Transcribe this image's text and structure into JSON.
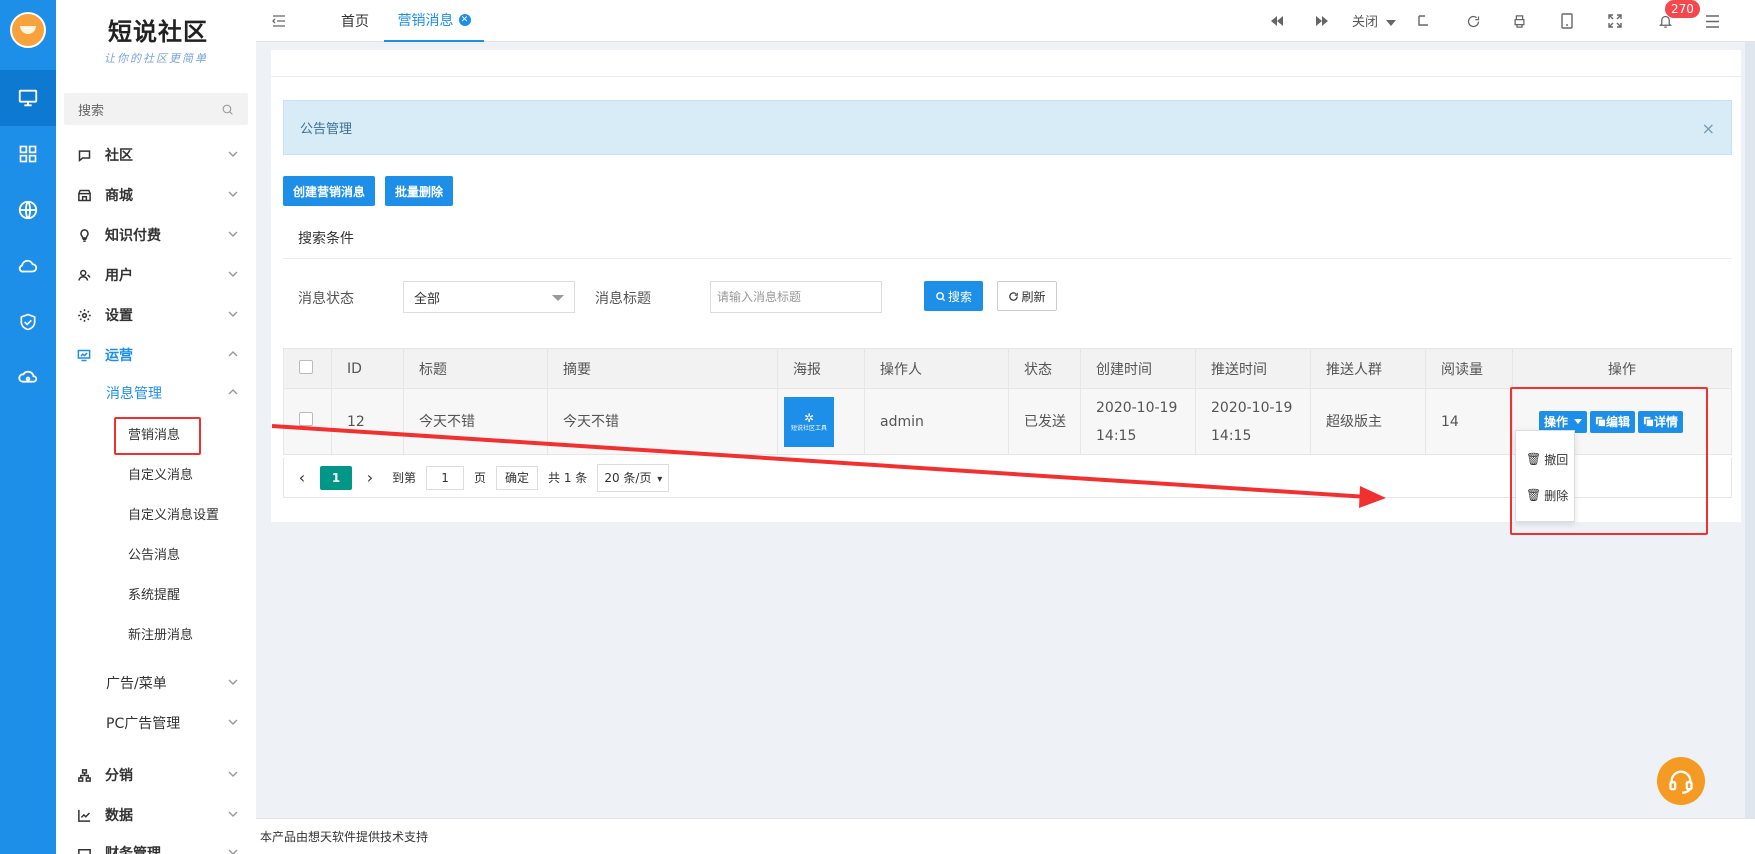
{
  "brand": {
    "name": "短说社区",
    "slogan": "让你的社区更简单"
  },
  "sidebar": {
    "search_placeholder": "搜索",
    "menu": [
      {
        "label": "社区"
      },
      {
        "label": "商城"
      },
      {
        "label": "知识付费"
      },
      {
        "label": "用户"
      },
      {
        "label": "设置"
      },
      {
        "label": "运营"
      }
    ],
    "sub_group": "消息管理",
    "sub_items": [
      "营销消息",
      "自定义消息",
      "自定义消息设置",
      "公告消息",
      "系统提醒",
      "新注册消息"
    ],
    "more": [
      "广告/菜单",
      "PC广告管理"
    ],
    "bottom_menu": [
      {
        "label": "分销"
      },
      {
        "label": "数据"
      },
      {
        "label": "财务管理"
      }
    ]
  },
  "topbar": {
    "tabs": [
      {
        "label": "首页"
      },
      {
        "label": "营销消息"
      }
    ],
    "close_label": "关闭",
    "notification_count": "270"
  },
  "alert": {
    "text": "公告管理",
    "close": "×"
  },
  "actions": {
    "create": "创建营销消息",
    "batch_delete": "批量删除"
  },
  "search": {
    "title": "搜索条件",
    "status_label": "消息状态",
    "status_value": "全部",
    "title_label": "消息标题",
    "title_placeholder": "请输入消息标题",
    "search_btn": "搜索",
    "refresh_btn": "刷新"
  },
  "table": {
    "headers": [
      "ID",
      "标题",
      "摘要",
      "海报",
      "操作人",
      "状态",
      "创建时间",
      "推送时间",
      "推送人群",
      "阅读量",
      "操作"
    ],
    "rows": [
      {
        "id": "12",
        "title": "今天不错",
        "summary": "今天不错",
        "poster_text": "短说社区工具",
        "operator": "admin",
        "status": "已发送",
        "created_date": "2020-10-19",
        "created_time": "14:15",
        "pushed_date": "2020-10-19",
        "pushed_time": "14:15",
        "audience": "超级版主",
        "reads": "14"
      }
    ],
    "op_buttons": {
      "ops": "操作",
      "edit": "编辑",
      "detail": "详情"
    },
    "dropdown": [
      "撤回",
      "删除"
    ]
  },
  "pagination": {
    "current": "1",
    "goto_label": "到第",
    "goto_value": "1",
    "page_unit": "页",
    "confirm": "确定",
    "total": "共 1 条",
    "page_size": "20 条/页"
  },
  "footer": {
    "text": "本产品由想天软件提供技术支持"
  },
  "colors": {
    "primary": "#1e8fe8",
    "rail": "#1e8fe8",
    "highlight": "#f23030",
    "teal": "#009688"
  }
}
